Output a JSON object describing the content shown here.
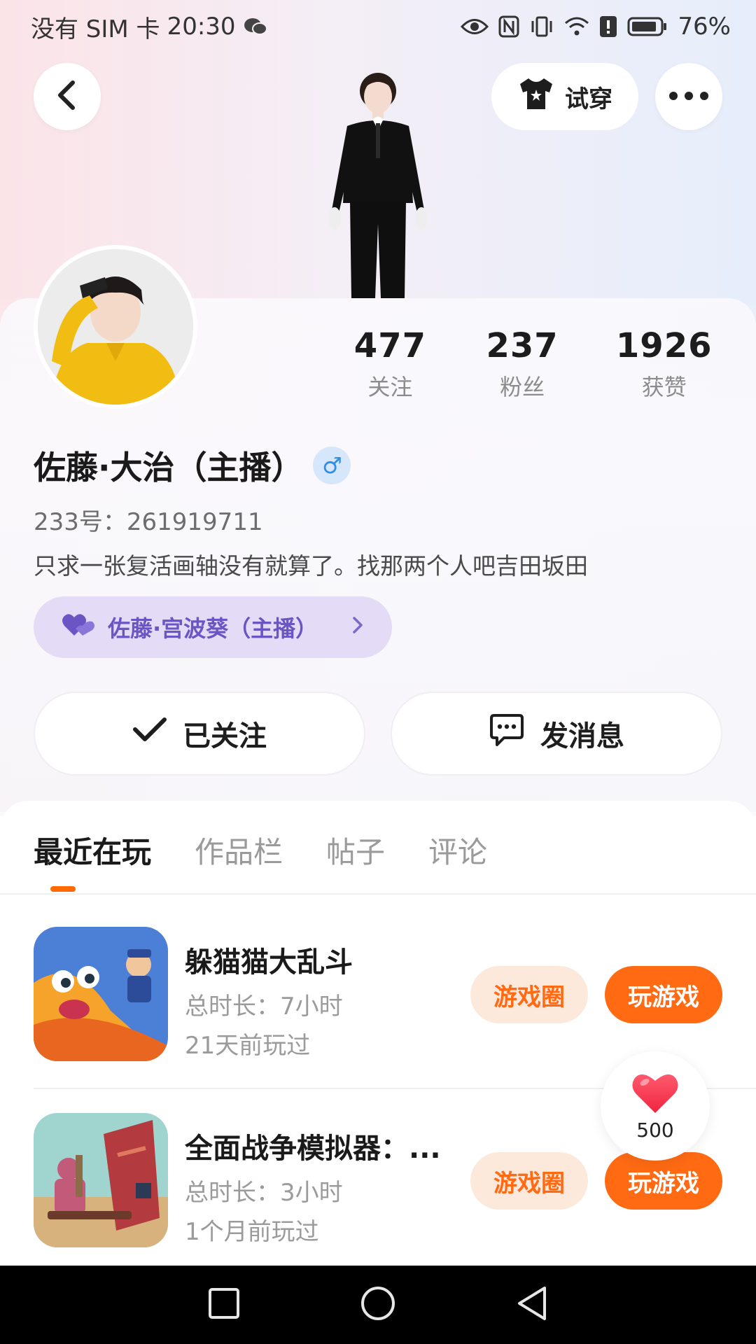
{
  "status_bar": {
    "carrier": "没有 SIM 卡",
    "time": "20:30",
    "battery": "76%"
  },
  "header": {
    "tryon_label": "试穿"
  },
  "stats": [
    {
      "value": "477",
      "label": "关注"
    },
    {
      "value": "237",
      "label": "粉丝"
    },
    {
      "value": "1926",
      "label": "获赞"
    }
  ],
  "profile": {
    "name": "佐藤·大治（主播）",
    "gender_symbol": "♂",
    "uid": "233号：261919711",
    "bio": "只求一张复活画轴没有就算了。找那两个人吧吉田坂田",
    "cp_name": "佐藤·宫波葵（主播）"
  },
  "actions": {
    "follow_label": "已关注",
    "message_label": "发消息"
  },
  "tabs": [
    {
      "label": "最近在玩",
      "active": true
    },
    {
      "label": "作品栏",
      "active": false
    },
    {
      "label": "帖子",
      "active": false
    },
    {
      "label": "评论",
      "active": false
    }
  ],
  "games": [
    {
      "title": "躲猫猫大乱斗",
      "duration": "总时长：7小时",
      "last_played": "21天前玩过",
      "circle_label": "游戏圈",
      "play_label": "玩游戏"
    },
    {
      "title": "全面战争模拟器：...",
      "duration": "总时长：3小时",
      "last_played": "1个月前玩过",
      "circle_label": "游戏圈",
      "play_label": "玩游戏"
    }
  ],
  "like_float": {
    "count": "500"
  },
  "colors": {
    "accent": "#ff6a13",
    "cp_purple": "#6b55c4",
    "gender_blue": "#2f8ee8"
  }
}
